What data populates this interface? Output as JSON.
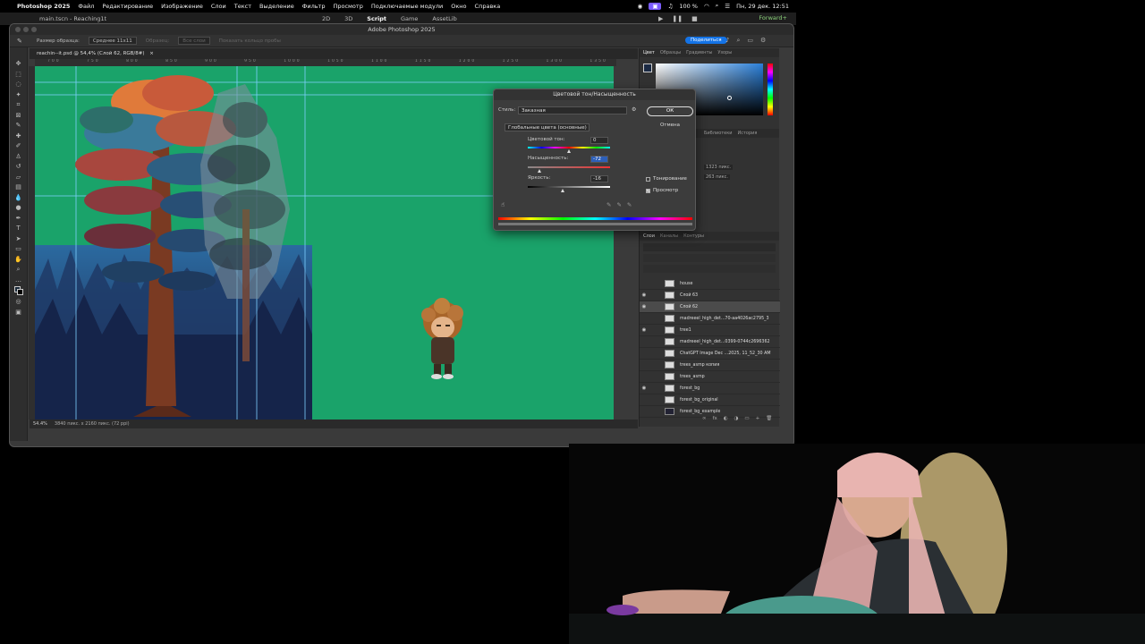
{
  "menubar": {
    "app_name": "Photoshop 2025",
    "items": [
      "Файл",
      "Редактирование",
      "Изображение",
      "Слои",
      "Текст",
      "Выделение",
      "Фильтр",
      "Просмотр",
      "Подключаемые модули",
      "Окно",
      "Справка"
    ],
    "battery": "100 %",
    "datetime": "Пн, 29 дек. 12:51"
  },
  "unity": {
    "scene_file": "main.tscn - Reaching1t",
    "tabs": [
      "2D",
      "3D",
      "Script",
      "Game",
      "AssetLib"
    ],
    "forward_label": "Forward+"
  },
  "photoshop": {
    "window_title": "Adobe Photoshop 2025",
    "options": {
      "sample_size_label": "Размер образца:",
      "sample_size_value": "Среднее 11x11",
      "sample_label": "Образец:",
      "sample_value": "Все слои",
      "show_ring": "Показать кольцо пробы"
    },
    "share_button": "Поделиться",
    "doc_tab": "reachin--it.psd @ 54,4% (Слой 62, RGB/8#)",
    "ruler_ticks": [
      "700",
      "750",
      "800",
      "850",
      "900",
      "950",
      "1000",
      "1050",
      "1100",
      "1150",
      "1200",
      "1250",
      "1300",
      "1350"
    ],
    "status_zoom": "54.4%",
    "status_size": "3840 пикс. x 2160 пикс. (72 ppi)"
  },
  "color_panel": {
    "tabs": [
      "Цвет",
      "Образцы",
      "Градиенты",
      "Узоры"
    ],
    "active_tab": "Цвет"
  },
  "properties_panel": {
    "tabs": [
      "Библиотеки",
      "История"
    ],
    "width_value": "1323 пикс.",
    "height_value": "263 пикс."
  },
  "layers_panel": {
    "tabs": [
      "Слои",
      "Каналы",
      "Контуры"
    ],
    "layers": [
      {
        "name": "house",
        "visible": false,
        "dark": false
      },
      {
        "name": "Слой 63",
        "visible": true,
        "dark": false
      },
      {
        "name": "Слой 62",
        "visible": true,
        "dark": false,
        "active": true
      },
      {
        "name": "madreeel_high_det...70-aa4026ac2795_3",
        "visible": false,
        "dark": false
      },
      {
        "name": "tree1",
        "visible": true,
        "dark": false
      },
      {
        "name": "madreeel_high_det...0399-0744c2696362",
        "visible": false,
        "dark": false
      },
      {
        "name": "ChatGPT Image Dec ...2025, 11_52_30 AM",
        "visible": false,
        "dark": false
      },
      {
        "name": "trees_asmp копия",
        "visible": false,
        "dark": false
      },
      {
        "name": "trees_asmp",
        "visible": false,
        "dark": false
      },
      {
        "name": "forest_bg",
        "visible": true,
        "dark": false
      },
      {
        "name": "forest_bg_original",
        "visible": false,
        "dark": false
      },
      {
        "name": "forest_bg_example",
        "visible": false,
        "dark": true
      }
    ]
  },
  "dialog": {
    "title": "Цветовой тон/Насыщенность",
    "style_label": "Стиль:",
    "style_value": "Заказная",
    "range_value": "Глобальные цвета (основные)",
    "hue_label": "Цветовой тон:",
    "hue_value": "0",
    "hue_pos": 0.5,
    "saturation_label": "Насыщенность:",
    "saturation_value": "-72",
    "saturation_pos": 0.14,
    "lightness_label": "Яркость:",
    "lightness_value": "-16",
    "lightness_pos": 0.42,
    "ok_label": "ОК",
    "cancel_label": "Отмена",
    "colorize_label": "Тонирование",
    "colorize_checked": false,
    "preview_label": "Просмотр",
    "preview_checked": true
  }
}
